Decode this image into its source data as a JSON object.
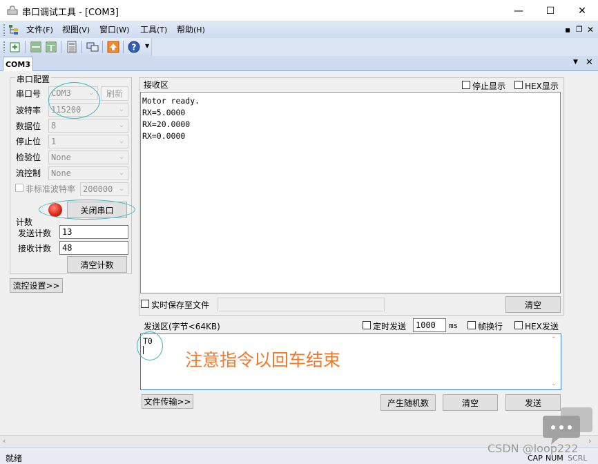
{
  "window": {
    "title": "串口调试工具 - [COM3]",
    "controls": {
      "minimize": "—",
      "maximize": "☐",
      "close": "✕"
    }
  },
  "menu": [
    {
      "label": "文件",
      "accel": "(F)"
    },
    {
      "label": "视图",
      "accel": "(V)"
    },
    {
      "label": "窗口",
      "accel": "(W)"
    },
    {
      "label": "工具",
      "accel": "(T)"
    },
    {
      "label": "帮助",
      "accel": "(H)"
    }
  ],
  "mdi_controls": {
    "minimize": "▪",
    "restore": "❐",
    "close": "✕"
  },
  "tab": {
    "label": "COM3"
  },
  "port_config": {
    "title": "串口配置",
    "port_label": "串口号",
    "port_value": "COM3",
    "refresh_label": "刷新",
    "baud_label": "波特率",
    "baud_value": "115200",
    "databits_label": "数据位",
    "databits_value": "8",
    "stopbits_label": "停止位",
    "stopbits_value": "1",
    "parity_label": "检验位",
    "parity_value": "None",
    "flow_label": "流控制",
    "flow_value": "None",
    "nonstd_label": "非标准波特率",
    "nonstd_value": "200000",
    "close_port_label": "关闭串口",
    "led_color": "#e0281a"
  },
  "counter": {
    "title": "计数",
    "sent_label": "发送计数",
    "sent_value": "13",
    "recv_label": "接收计数",
    "recv_value": "48",
    "clear_label": "清空计数"
  },
  "flow_settings_label": "流控设置>>",
  "receive": {
    "title": "接收区",
    "stop_display_label": "停止显示",
    "hex_display_label": "HEX显示",
    "lines": [
      "Motor ready.",
      "RX=5.0000",
      "RX=20.0000",
      "RX=0.0000"
    ],
    "save_label": "实时保存至文件",
    "save_path": "",
    "clear_label": "清空"
  },
  "send": {
    "title": "发送区(字节<64KB)",
    "timed_label": "定时发送",
    "interval_value": "1000",
    "interval_unit": "ms",
    "newline_label": "帧换行",
    "hex_send_label": "HEX发送",
    "text": "T0",
    "annotation": "注意指令以回车结束",
    "annotation_color": "#f07a2a",
    "file_transfer_label": "文件传输>>",
    "random_label": "产生随机数",
    "clear_label": "清空",
    "send_label": "发送"
  },
  "status": {
    "text": "就绪",
    "watermark": "CSDN @loop222",
    "indicators": [
      "CAP",
      "NUM",
      "SCRL"
    ]
  }
}
